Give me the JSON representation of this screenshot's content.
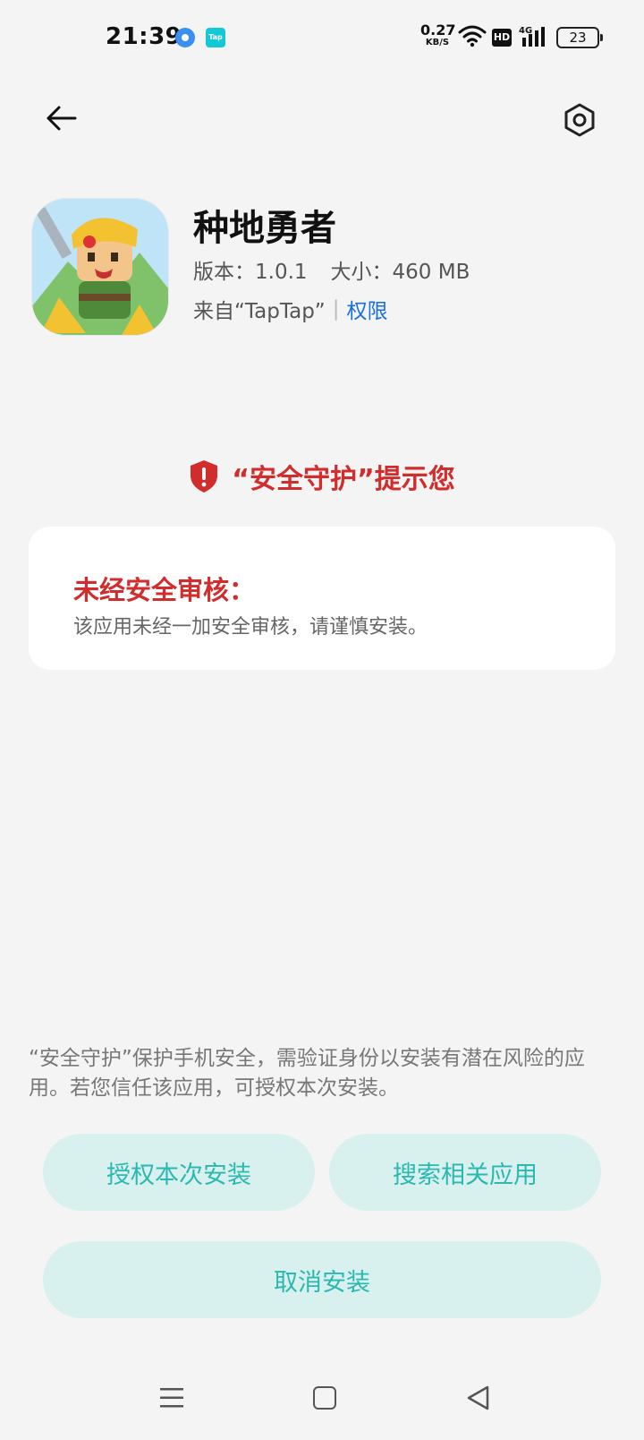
{
  "status_bar": {
    "time": "21:39",
    "net_speed_value": "0.27",
    "net_speed_unit": "KB/S",
    "hd_label": "HD",
    "network_type": "4G",
    "battery": "23",
    "notification_icons": [
      "browser-icon",
      "taptap-icon"
    ],
    "taptap_label": "Tap"
  },
  "header": {
    "back_icon": "arrow-left-icon",
    "settings_icon": "hexagon-settings-icon"
  },
  "app": {
    "name": "种地勇者",
    "version_label": "版本：1.0.1",
    "size_label": "大小：460 MB",
    "source_label": "来自“TapTap”",
    "separator": "|",
    "permissions_link": "权限"
  },
  "security": {
    "title": "“安全守护”提示您",
    "shield_color": "#d12d2d",
    "card_heading": "未经安全审核：",
    "card_text": "该应用未经一加安全审核，请谨慎安装。"
  },
  "footer": {
    "description": "“安全守护”保护手机安全，需验证身份以安装有潜在风险的应用。若您信任该应用，可授权本次安装。",
    "authorize_button": "授权本次安装",
    "search_button": "搜索相关应用",
    "cancel_button": "取消安装",
    "button_bg": "#d8f0ee",
    "button_text_color": "#2bb8b0"
  },
  "nav": {
    "icons": [
      "menu-icon",
      "home-icon",
      "back-triangle-icon"
    ]
  }
}
